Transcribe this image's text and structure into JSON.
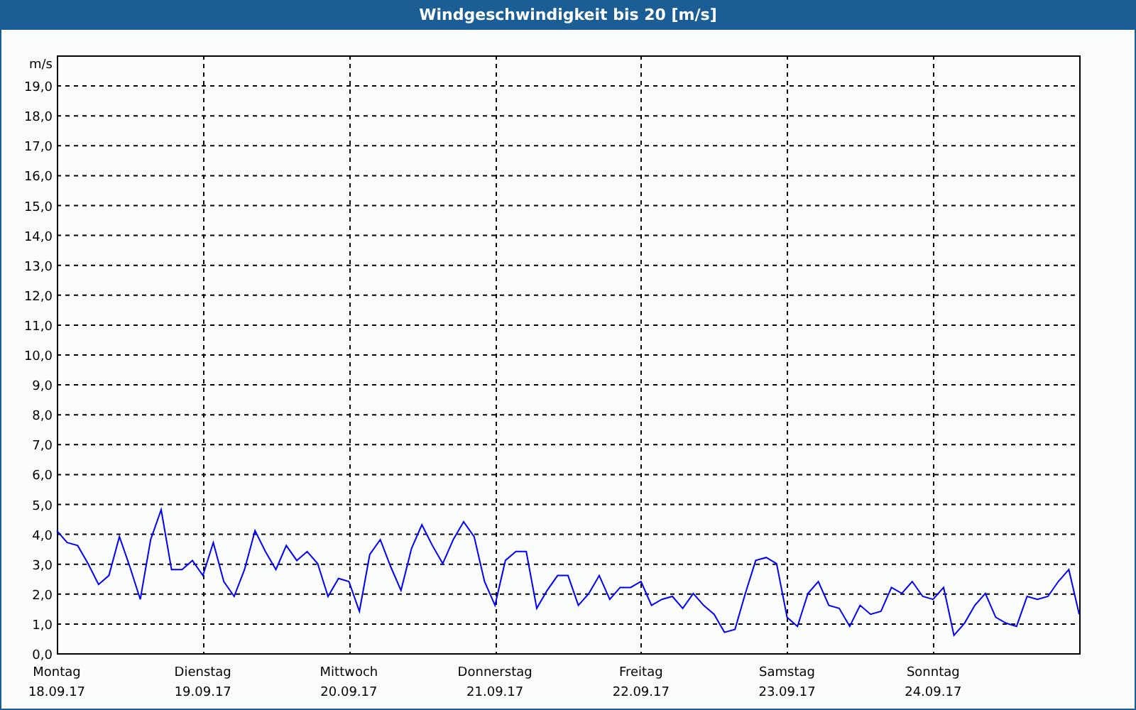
{
  "window": {
    "title": "Windgeschwindigkeit bis 20 [m/s]"
  },
  "chart": {
    "chart_data": {
      "type": "line",
      "ylabel": "m/s",
      "grid": true,
      "ylim": [
        0,
        20
      ],
      "yticks": [
        {
          "value": 0,
          "label": "0,0"
        },
        {
          "value": 1,
          "label": "1,0"
        },
        {
          "value": 2,
          "label": "2,0"
        },
        {
          "value": 3,
          "label": "3,0"
        },
        {
          "value": 4,
          "label": "4,0"
        },
        {
          "value": 5,
          "label": "5,0"
        },
        {
          "value": 6,
          "label": "6,0"
        },
        {
          "value": 7,
          "label": "7,0"
        },
        {
          "value": 8,
          "label": "8,0"
        },
        {
          "value": 9,
          "label": "9,0"
        },
        {
          "value": 10,
          "label": "10,0"
        },
        {
          "value": 11,
          "label": "11,0"
        },
        {
          "value": 12,
          "label": "12,0"
        },
        {
          "value": 13,
          "label": "13,0"
        },
        {
          "value": 14,
          "label": "14,0"
        },
        {
          "value": 15,
          "label": "15,0"
        },
        {
          "value": 16,
          "label": "16,0"
        },
        {
          "value": 17,
          "label": "17,0"
        },
        {
          "value": 18,
          "label": "18,0"
        },
        {
          "value": 19,
          "label": "19,0"
        }
      ],
      "categories": [
        "Montag\n18.09.17",
        null,
        null,
        null,
        null,
        null,
        null,
        null,
        null,
        null,
        null,
        null,
        null,
        null,
        "Dienstag\n19.09.17",
        null,
        null,
        null,
        null,
        null,
        null,
        null,
        null,
        null,
        null,
        null,
        null,
        null,
        "Mittwoch\n20.09.17",
        null,
        null,
        null,
        null,
        null,
        null,
        null,
        null,
        null,
        null,
        null,
        null,
        null,
        "Donnerstag\n21.09.17",
        null,
        null,
        null,
        null,
        null,
        null,
        null,
        null,
        null,
        null,
        null,
        null,
        null,
        "Freitag\n22.09.17",
        null,
        null,
        null,
        null,
        null,
        null,
        null,
        null,
        null,
        null,
        null,
        null,
        null,
        "Samstag\n23.09.17",
        null,
        null,
        null,
        null,
        null,
        null,
        null,
        null,
        null,
        null,
        null,
        null,
        null,
        "Sonntag\n24.09.17",
        null,
        null,
        null,
        null,
        null,
        null,
        null,
        null,
        null,
        null,
        null,
        null,
        null,
        null
      ],
      "series": [
        {
          "color": "#0000ff",
          "values": [
            4.1,
            3.7,
            3.6,
            3.0,
            2.3,
            2.6,
            3.9,
            2.9,
            1.8,
            3.8,
            4.8,
            2.8,
            2.8,
            3.1,
            2.6,
            3.7,
            2.4,
            1.9,
            2.8,
            4.1,
            3.4,
            2.8,
            3.6,
            3.1,
            3.4,
            3.0,
            1.9,
            2.5,
            2.4,
            1.4,
            3.3,
            3.8,
            2.9,
            2.1,
            3.5,
            4.3,
            3.6,
            3.0,
            3.8,
            4.4,
            3.9,
            2.4,
            1.6,
            3.1,
            3.4,
            3.4,
            1.5,
            2.1,
            2.6,
            2.6,
            1.6,
            2.0,
            2.6,
            1.8,
            2.2,
            2.2,
            2.4,
            1.6,
            1.8,
            1.9,
            1.5,
            2.0,
            1.6,
            1.3,
            0.7,
            0.8,
            2.0,
            3.1,
            3.2,
            3.0,
            1.2,
            0.9,
            2.0,
            2.4,
            1.6,
            1.5,
            0.9,
            1.6,
            1.3,
            1.4,
            2.2,
            2.0,
            2.4,
            1.9,
            1.8,
            2.2,
            0.6,
            1.0,
            1.6,
            2.0,
            1.2,
            1.0,
            0.9,
            1.9,
            1.8,
            1.9,
            2.4,
            2.8,
            1.3
          ]
        }
      ]
    }
  }
}
